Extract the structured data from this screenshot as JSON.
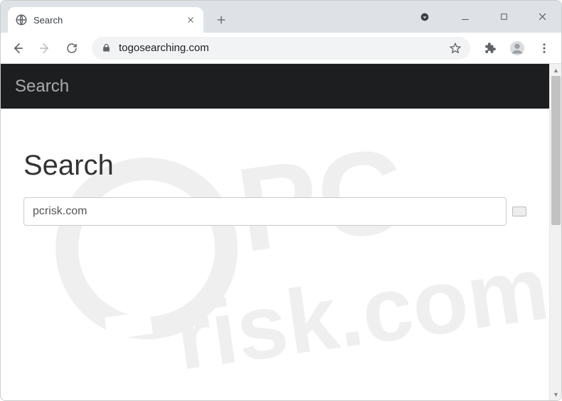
{
  "window": {
    "tab_title": "Search"
  },
  "toolbar": {
    "url": "togosearching.com"
  },
  "page": {
    "header_title": "Search",
    "main_heading": "Search",
    "search_value": "pcrisk.com"
  },
  "watermark": {
    "line1": "PC",
    "line2": "risk.com"
  }
}
